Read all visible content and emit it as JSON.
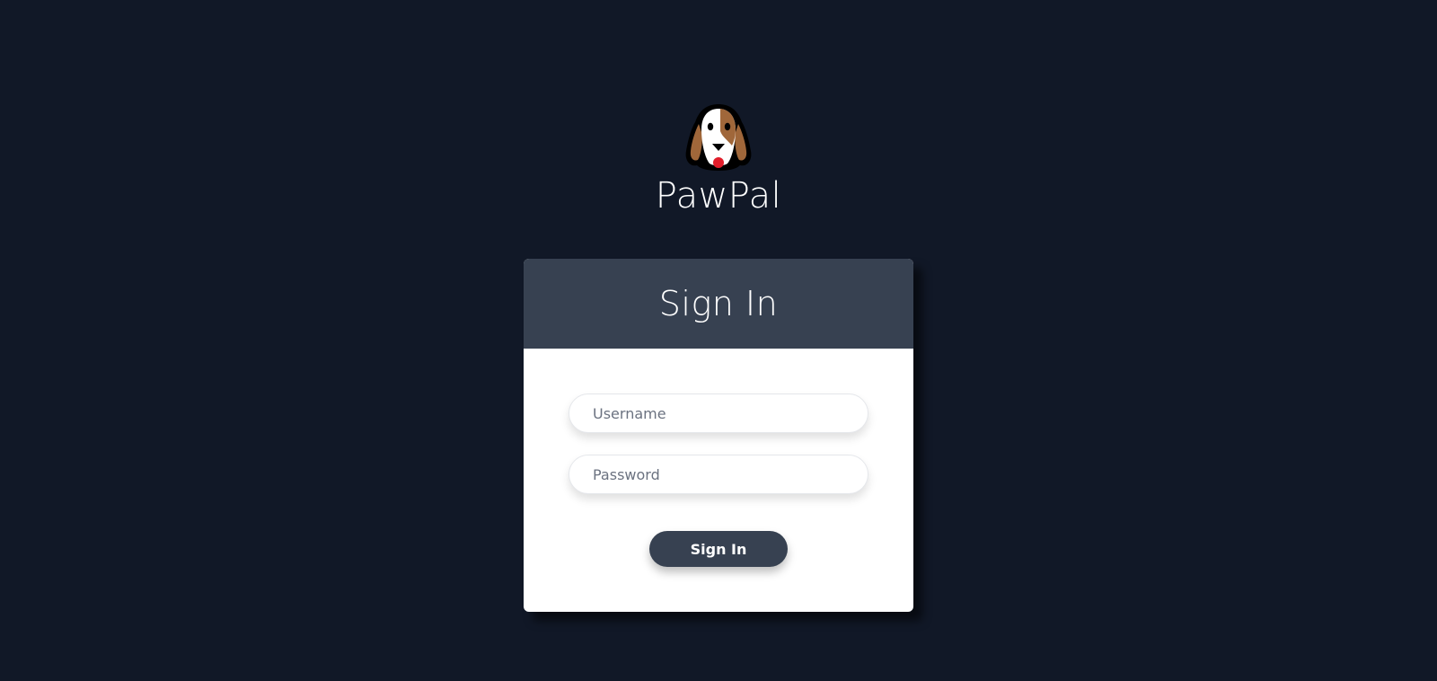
{
  "brand": {
    "name": "PawPal",
    "logo_icon": "dog-face-icon"
  },
  "signin": {
    "title": "Sign In",
    "username_placeholder": "Username",
    "username_value": "",
    "password_placeholder": "Password",
    "password_value": "",
    "submit_label": "Sign In"
  },
  "colors": {
    "background": "#111827",
    "header": "#374151",
    "card": "#ffffff",
    "button": "#374151"
  }
}
